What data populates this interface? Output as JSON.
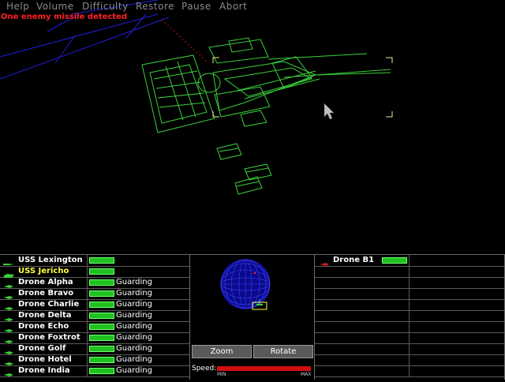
{
  "menu": [
    "Help",
    "Volume",
    "Difficulty",
    "Restore",
    "Pause",
    "Abort"
  ],
  "alert": "One enemy missile detected",
  "colors": {
    "wireframe": "#3ad03a",
    "grid": "#1f1fd8",
    "alert": "#ff2020",
    "selected": "#ffff40",
    "health": "#20c020"
  },
  "fleet": [
    {
      "name": "USS Lexington",
      "icon": "cruiser-icon",
      "status": "",
      "health": 1.0
    },
    {
      "name": "USS Jericho",
      "icon": "carrier-icon",
      "status": "",
      "health": 1.0,
      "selected": true
    },
    {
      "name": "Drone Alpha",
      "icon": "drone-icon",
      "status": "Guarding",
      "health": 1.0
    },
    {
      "name": "Drone Bravo",
      "icon": "drone-icon",
      "status": "Guarding",
      "health": 1.0
    },
    {
      "name": "Drone Charlie",
      "icon": "drone-icon",
      "status": "Guarding",
      "health": 1.0
    },
    {
      "name": "Drone Delta",
      "icon": "drone-icon",
      "status": "Guarding",
      "health": 1.0
    },
    {
      "name": "Drone Echo",
      "icon": "drone-icon",
      "status": "Guarding",
      "health": 1.0
    },
    {
      "name": "Drone Foxtrot",
      "icon": "drone-icon",
      "status": "Guarding",
      "health": 1.0
    },
    {
      "name": "Drone Golf",
      "icon": "drone-icon",
      "status": "Guarding",
      "health": 1.0
    },
    {
      "name": "Drone Hotel",
      "icon": "drone-icon",
      "status": "Guarding",
      "health": 1.0
    },
    {
      "name": "Drone India",
      "icon": "drone-icon",
      "status": "Guarding",
      "health": 1.0
    }
  ],
  "targets": [
    {
      "name": "Drone B1",
      "icon": "enemy-drone-icon",
      "health": 1.0
    }
  ],
  "controls": {
    "zoom": "Zoom",
    "rotate": "Rotate"
  },
  "speed": {
    "label": "Speed:",
    "min": "MIN",
    "max": "MAX",
    "value": 1.0
  }
}
